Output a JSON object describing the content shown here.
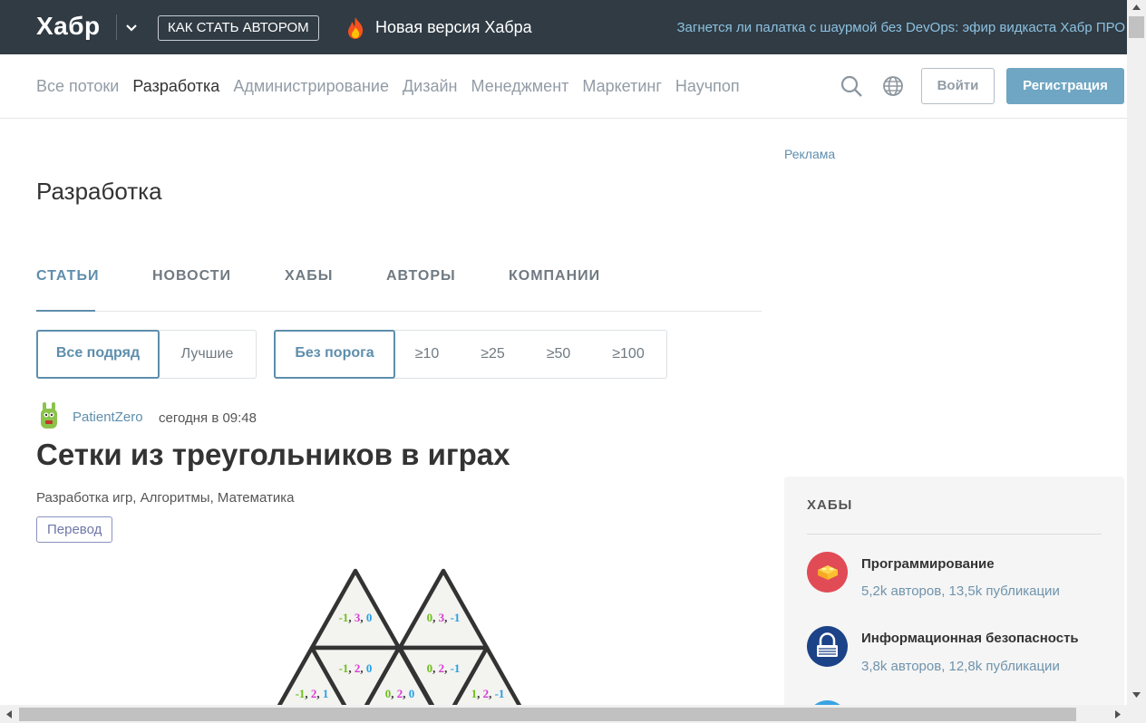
{
  "topbar": {
    "logo": "Хабр",
    "author_button": "КАК СТАТЬ АВТОРОМ",
    "new_version": "Новая версия Хабра",
    "promo": "Загнется ли палатка с шаурмой без DevOps: эфир видкаста Хабр ПРО"
  },
  "nav": {
    "links": [
      "Все потоки",
      "Разработка",
      "Администрирование",
      "Дизайн",
      "Менеджмент",
      "Маркетинг",
      "Научпоп"
    ],
    "active": "Разработка",
    "login": "Войти",
    "register": "Регистрация"
  },
  "main": {
    "title": "Разработка",
    "tabs": [
      "СТАТЬИ",
      "НОВОСТИ",
      "ХАБЫ",
      "АВТОРЫ",
      "КОМПАНИИ"
    ],
    "active_tab": "СТАТЬИ",
    "sort_filters": [
      "Все подряд",
      "Лучшие"
    ],
    "rating_filters": [
      "Без порога",
      "≥10",
      "≥25",
      "≥50",
      "≥100"
    ]
  },
  "post": {
    "author": "PatientZero",
    "time": "сегодня в 09:48",
    "title": "Сетки из треугольников в играх",
    "hubs": "Разработка игр,  Алгоритмы,  Математика",
    "badge": "Перевод",
    "illustration_labels": [
      [
        "-1",
        "3",
        "0"
      ],
      [
        "0",
        "3",
        "-1"
      ],
      [
        "-1",
        "2",
        "0"
      ],
      [
        "0",
        "2",
        "-1"
      ],
      [
        "-1",
        "2",
        "1"
      ],
      [
        "0",
        "2",
        "0"
      ],
      [
        "1",
        "2",
        "-1"
      ]
    ]
  },
  "sidebar": {
    "ad_label": "Реклама",
    "hubs_title": "ХАБЫ",
    "hubs": [
      {
        "name": "Программирование",
        "stats": "5,2k авторов, 13,5k публикации",
        "color": "#e14b55"
      },
      {
        "name": "Информационная безопасность",
        "stats": "3,8k авторов, 12,8k публикации",
        "color": "#1c4287"
      }
    ]
  },
  "colors": {
    "topbar_bg": "#303b44",
    "accent": "#5e8eac",
    "register_bg": "#6fa6c3",
    "coord_green": "#6fbf1e",
    "coord_magenta": "#d63ad6",
    "coord_blue": "#28a0e8"
  }
}
